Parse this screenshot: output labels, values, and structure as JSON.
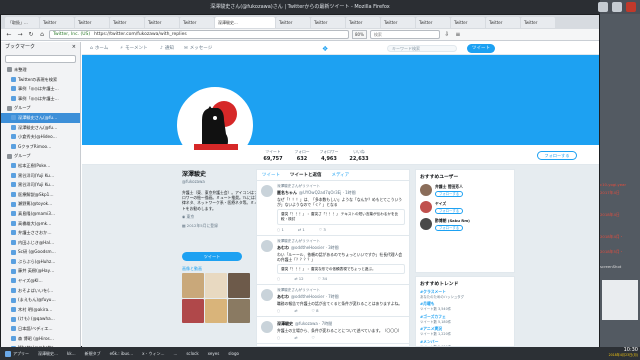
{
  "window": {
    "title": "深澤駿史さん(@fukozawa)さん | Twitterからの最新ツイート - Mozilla Firefox"
  },
  "tabs": [
    "「取扱」...",
    "Twitter",
    "Twitter",
    "Twitter",
    "Twitter",
    "Twitter",
    "深澤駿史...",
    "Twitter",
    "Twitter",
    "Twitter",
    "Twitter",
    "Twitter",
    "Twitter",
    "Twitter",
    "Twitter"
  ],
  "navbar": {
    "site_label": "Twitter, Inc. (US)",
    "url": "https://twitter.com/fukozawa/with_replies",
    "zoom": "80%",
    "search_placeholder": "検索"
  },
  "sidebar": {
    "title": "ブックマーク",
    "items": [
      {
        "label": "未整理",
        "folder": true
      },
      {
        "label": "Twitterの表現を検索",
        "folder": false
      },
      {
        "label": "事例「◎◎は弁護士…",
        "folder": false
      },
      {
        "label": "事例「◎◎は弁護士…",
        "folder": false
      },
      {
        "label": "グループ",
        "folder": true
      },
      {
        "label": "深澤駿史さん(@fu…",
        "folder": false,
        "selected": true
      },
      {
        "label": "深澤駿史さん(@fu…",
        "folder": false
      },
      {
        "label": "小倉秀夫(@Hideo…",
        "folder": false
      },
      {
        "label": "GクラブRimoo…",
        "folder": false
      },
      {
        "label": "グループ",
        "folder": true
      },
      {
        "label": "松本正樹(Poke…",
        "folder": false
      },
      {
        "label": "黒谷洋司(Yuji Ku…",
        "folder": false
      },
      {
        "label": "黒谷洋司(Yuji Ku…",
        "folder": false
      },
      {
        "label": "医療解説@Skp1…",
        "folder": false
      },
      {
        "label": "瀬野篤(@toyok…",
        "folder": false
      },
      {
        "label": "真島隆(@mami3…",
        "folder": false
      },
      {
        "label": "高橋雄大(@mk…",
        "folder": false
      },
      {
        "label": "弁護士ささおか…",
        "folder": false
      },
      {
        "label": "内田ふじき@Hal…",
        "folder": false
      },
      {
        "label": "Sc研 (@Goodsm…",
        "folder": false
      },
      {
        "label": "ぶらぶら(@Huhz…",
        "folder": false
      },
      {
        "label": "藤井 英樹(@Hay…",
        "folder": false
      },
      {
        "label": "ヤイズ@KI…",
        "folder": false
      },
      {
        "label": "おそよばいいを(…",
        "folder": false
      },
      {
        "label": "(まえもん)@fuyu…",
        "folder": false
      },
      {
        "label": "木村 明(@akira…",
        "folder": false
      },
      {
        "label": "(けも) (@qawha…",
        "folder": false
      },
      {
        "label": "日本語/ベディエ…",
        "folder": false
      },
      {
        "label": "森 博昭 (@Hiros…",
        "folder": false
      },
      {
        "label": "Mhotta(@mhotta…",
        "folder": false
      },
      {
        "label": "桃谷勝善(@mous…",
        "folder": false
      },
      {
        "label": "井上能代(@inou…",
        "folder": false
      }
    ]
  },
  "twitter": {
    "nav": {
      "home": "ホーム",
      "moments": "モーメント",
      "notifications": "通知",
      "messages": "メッセージ"
    },
    "search_placeholder": "キーワード検索",
    "tweet_button": "ツイート",
    "stats": [
      {
        "label": "ツイート",
        "value": "69,757"
      },
      {
        "label": "フォロー",
        "value": "632"
      },
      {
        "label": "フォロワー",
        "value": "4,963"
      },
      {
        "label": "いいね",
        "value": "22,633"
      }
    ],
    "follow_button": "フォローする",
    "profile": {
      "name": "深澤駿史",
      "handle": "@fukozawa",
      "bio": "弁護士（東、東京弁護士会）。アイコンはフォロワーの絵～描画。ミュート推奨。TLには法律ネタ、ネットワーク系・医療ネタ等。ミュートをお勧めします。",
      "location": "東京",
      "joined": "2012年5月に登録",
      "tweet_button": "ツイート",
      "media_title": "画像と動画"
    },
    "timeline": {
      "tabs": [
        "ツイート",
        "ツイートと返信",
        "メディア"
      ],
      "active_tab": 1,
      "tweets": [
        {
          "context": "深澤駿史さんがリツイート",
          "author": "匿名ちゃん",
          "handle": "@UYOwQ2ad7qOr3Ej · 1時間",
          "body": "なぜ「！！！」は、「多本数もしい」ような「なんか？めもとてこういうが」ないようなので「く？」となる",
          "quote": "唐突「！！！」 ：唐突さ「！！！」 テキストの短い言葉が伝わるかを比較・検討",
          "actions": [
            "1",
            "1",
            "3"
          ]
        },
        {
          "context": "深澤駿史さんがリツイート",
          "author": "あむわ",
          "handle": "@oddtheHoosier · 3時間",
          "body": "わい「ルーール、依頼の話があるのでちょっといいですか」社長代理人会の弁護士「？？？？」",
          "quote": "唐突「！！！」 ：唐突な形での依頼表現でちょっと遊ぶ。",
          "actions": [
            "",
            "12",
            "34"
          ]
        },
        {
          "context": "深澤駿史さんがリツイート",
          "author": "あむわ",
          "handle": "@oddtheHoosier · 7時間",
          "body": "職務の報告で弁護士の話が出てくると条件が変わることはありますよね。",
          "quote": "",
          "actions": [
            "",
            "",
            "8"
          ]
        },
        {
          "context": "",
          "author": "深澤駿史",
          "handle": "@fukozawa · 7時間",
          "body": "弁護士の立場から、条件が変わることについて述べています。（〇〇〇）",
          "quote": "",
          "actions": [
            "",
            "",
            ""
          ]
        }
      ]
    },
    "who_to_follow": {
      "title": "おすすめユーザー",
      "users": [
        {
          "name": "弁護士 菅田芳人",
          "button": "フォローする",
          "color": "#8a6d5a"
        },
        {
          "name": "ヤイズ",
          "button": "フォローする",
          "color": "#c0504d"
        },
        {
          "name": "酢博朗 (Saku Rm)",
          "button": "フォローする",
          "color": "#4a4a4a"
        }
      ]
    },
    "trends": {
      "title": "おすすめトレンド",
      "items": [
        {
          "name": "#クラスメート",
          "sub": "あなたのためのハッシュタグ"
        },
        {
          "name": "#月曜も",
          "sub": "ツイート数 3,540件"
        },
        {
          "name": "#ゴーズカフェ",
          "sub": "ツイート数 5,180件"
        },
        {
          "name": "#アニメ実況",
          "sub": "ツイート数 1,220件"
        },
        {
          "name": "#メンバー",
          "sub": "ツイート数 2,030件"
        },
        {
          "name": "#deep1234",
          "sub": "ツイート数 1,000件"
        }
      ]
    }
  },
  "desktop_right": {
    "notes": [
      "2017年4日",
      "2018年4日",
      "c10-yogi-year",
      "2018年4月・",
      "2018年5月・",
      "screenShot"
    ]
  },
  "taskbar": {
    "items": [
      "アプリー",
      "深澤駿史…",
      "kk…",
      "新規タブ",
      "e6k.: ibus…",
      "x - ウィン…",
      "...",
      "sclock",
      "xeyes",
      "slogo"
    ],
    "time": "10:30",
    "date": "2018年4月23日(月)"
  },
  "colors": {
    "twitter_blue": "#1da1f2",
    "sidebar_selection": "#3d8fd8"
  }
}
